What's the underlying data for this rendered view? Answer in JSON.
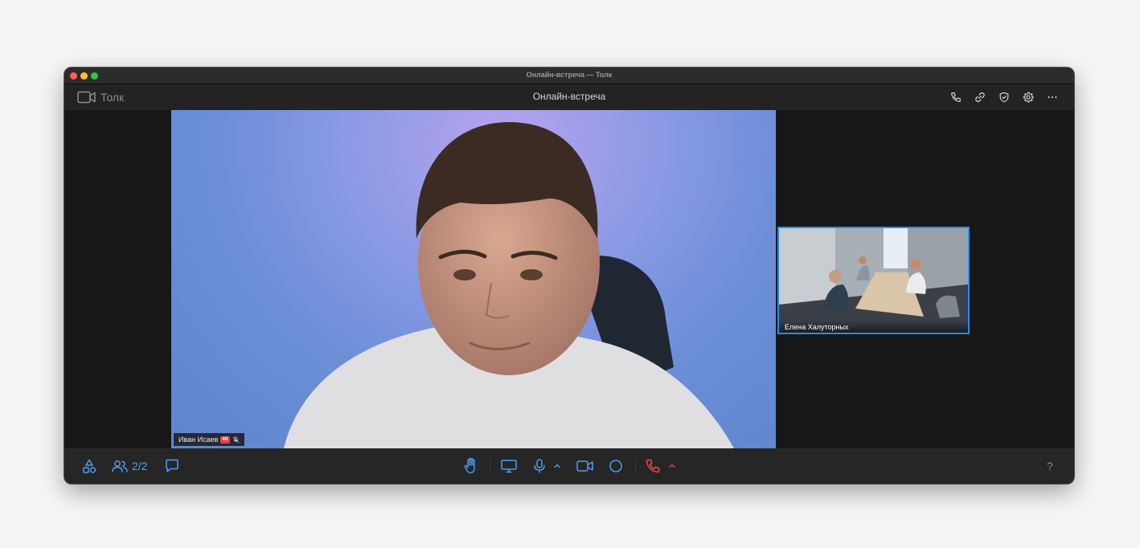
{
  "window": {
    "title": "Онлайн-встреча — Толк"
  },
  "app": {
    "name": "Толк",
    "meeting_title": "Онлайн-встреча"
  },
  "top_actions": [
    "phone-icon",
    "link-icon",
    "shield-check-icon",
    "gear-icon",
    "more-icon"
  ],
  "participants": {
    "main": {
      "name": "Иван Исаев",
      "badge": "4K",
      "muted": true
    },
    "secondary": {
      "name": "Елена Халуторных",
      "active_speaker": true
    }
  },
  "controls": {
    "participants_count": "2/2",
    "help_label": "?",
    "left": [
      "shapes-icon",
      "people-icon",
      "chat-icon"
    ],
    "center": [
      "raise-hand-icon",
      "screen-share-icon",
      "microphone-icon",
      "chevron-up-icon",
      "camera-icon",
      "record-icon",
      "end-call-icon",
      "chevron-up-icon"
    ]
  },
  "colors": {
    "accent": "#4a9ff2",
    "end_call": "#e2454d",
    "active_border": "#1f8ef1",
    "background": "#171717"
  }
}
